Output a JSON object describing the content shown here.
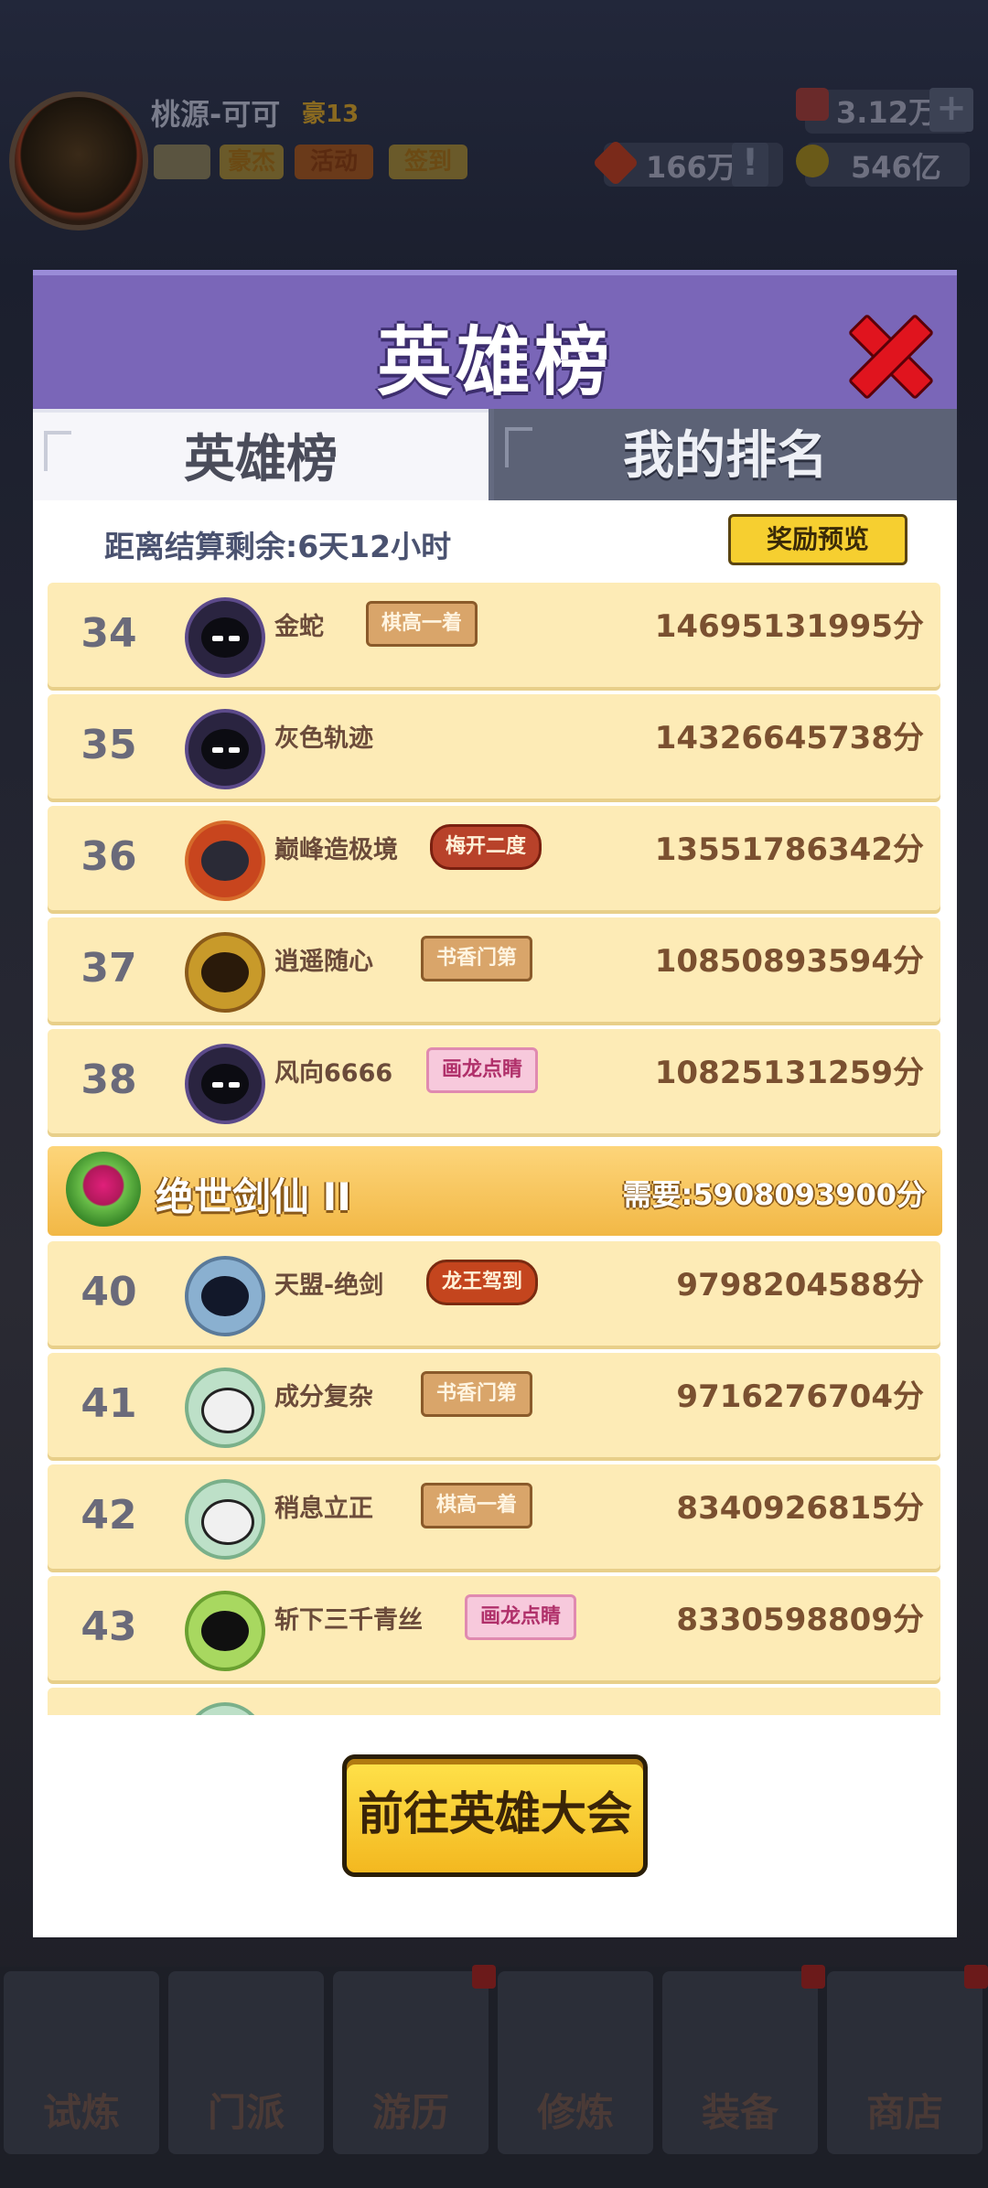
{
  "player": {
    "name": "桃源-可可",
    "level": "豪13",
    "chips": [
      "豪杰",
      "活动",
      "签到"
    ]
  },
  "resources": {
    "gems": "3.12万",
    "tokens": "166万",
    "gold": "546亿"
  },
  "modal": {
    "title": "英雄榜",
    "tabs": [
      "英雄榜",
      "我的排名"
    ],
    "countdown": "距离结算剩余:6天12小时",
    "reward_button": "奖励预览",
    "go_button": "前往英雄大会"
  },
  "rows_top": [
    {
      "rank": "34",
      "name": "金蛇",
      "tag": "棋高一着",
      "tag_style": "brown",
      "score": "14695131995分"
    },
    {
      "rank": "35",
      "name": "灰色轨迹",
      "tag": "",
      "tag_style": "",
      "score": "14326645738分"
    },
    {
      "rank": "36",
      "name": "巅峰造极境",
      "tag": "梅开二度",
      "tag_style": "redflower",
      "score": "13551786342分"
    },
    {
      "rank": "37",
      "name": "逍遥随心",
      "tag": "书香门第",
      "tag_style": "brown",
      "score": "10850893594分"
    },
    {
      "rank": "38",
      "name": "风向6666",
      "tag": "画龙点睛",
      "tag_style": "pink",
      "score": "10825131259分"
    }
  ],
  "tier": {
    "name": "绝世剑仙 II",
    "requirement": "需要:5908093900分"
  },
  "rows_bottom": [
    {
      "rank": "40",
      "name": "天盟-绝剑",
      "tag": "龙王驾到",
      "tag_style": "red",
      "score": "9798204588分"
    },
    {
      "rank": "41",
      "name": "成分复杂",
      "tag": "书香门第",
      "tag_style": "brown",
      "score": "9716276704分"
    },
    {
      "rank": "42",
      "name": "稍息立正",
      "tag": "棋高一着",
      "tag_style": "brown",
      "score": "8340926815分"
    },
    {
      "rank": "43",
      "name": "斩下三千青丝",
      "tag": "画龙点睛",
      "tag_style": "pink",
      "score": "8330598809分"
    }
  ],
  "bottom_nav": [
    "试炼",
    "门派",
    "游历",
    "修炼",
    "装备",
    "商店"
  ]
}
